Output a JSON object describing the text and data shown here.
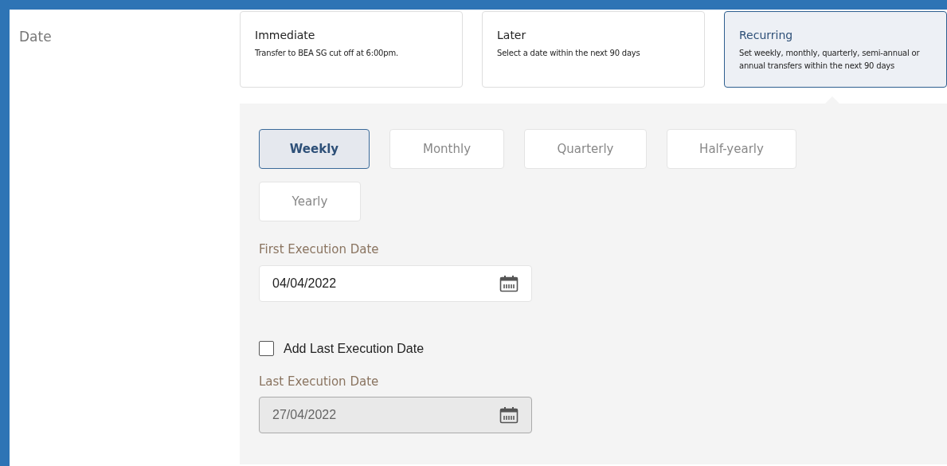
{
  "field_label": "Date",
  "date_options": [
    {
      "title": "Immediate",
      "description": "Transfer to BEA SG cut off at 6:00pm.",
      "selected": false
    },
    {
      "title": "Later",
      "description": "Select a date within the next 90 days",
      "selected": false
    },
    {
      "title": "Recurring",
      "description": "Set weekly, monthly, quarterly, semi-annual or annual transfers within the next 90 days",
      "selected": true
    }
  ],
  "frequencies": [
    {
      "label": "Weekly",
      "selected": true
    },
    {
      "label": "Monthly",
      "selected": false
    },
    {
      "label": "Quarterly",
      "selected": false
    },
    {
      "label": "Half-yearly",
      "selected": false
    },
    {
      "label": "Yearly",
      "selected": false
    }
  ],
  "first_execution": {
    "label": "First Execution Date",
    "value": "04/04/2022",
    "disabled": false
  },
  "add_last_execution": {
    "label": "Add Last Execution Date",
    "checked": false
  },
  "last_execution": {
    "label": "Last Execution Date",
    "value": "27/04/2022",
    "disabled": true
  }
}
